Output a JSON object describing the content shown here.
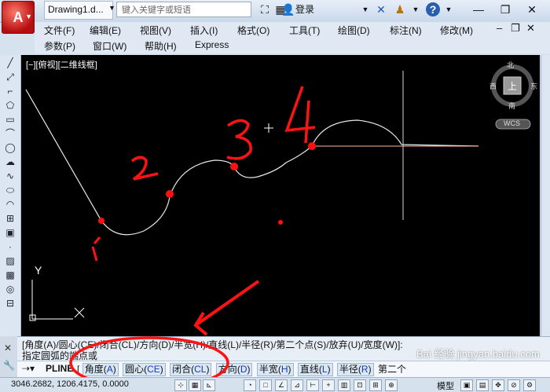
{
  "titlebar": {
    "doc_title": "Drawing1.d...",
    "search_placeholder": "键入关键字或短语",
    "login": "登录"
  },
  "menu": {
    "row1": [
      "文件(F)",
      "编辑(E)",
      "视图(V)",
      "插入(I)",
      "格式(O)",
      "工具(T)",
      "绘图(D)",
      "标注(N)",
      "修改(M)"
    ],
    "row2": [
      "参数(P)",
      "窗口(W)",
      "帮助(H)",
      "Express"
    ]
  },
  "canvas": {
    "view_label": "[−][俯视][二维线框]",
    "viewcube": {
      "north": "北",
      "south": "南",
      "east": "东",
      "west": "西",
      "top": "上",
      "wcs": "WCS"
    },
    "ucs_y": "Y",
    "annotations": [
      "1",
      "2",
      "3",
      "4"
    ]
  },
  "command": {
    "history": "[角度(A)/圆心(CE)/闭合(CL)/方向(D)/半宽(H)/直线(L)/半径(R)/第二个点(S)/放弃(U)/宽度(W)]:",
    "prompt": "指定圆弧的端点或",
    "pline": "PLINE",
    "bracket_open": "[",
    "options": [
      {
        "label": "角度",
        "key": "A"
      },
      {
        "label": "圆心",
        "key": "CE"
      },
      {
        "label": "闭合",
        "key": "CL"
      }
    ],
    "plain_options": [
      {
        "label": "方向",
        "key": "D"
      },
      {
        "label": "半宽",
        "key": "H"
      },
      {
        "label": "直线",
        "key": "L"
      },
      {
        "label": "半径",
        "key": "R"
      }
    ],
    "tail": "第二个"
  },
  "statusbar": {
    "coords": "3046.2682, 1206.4175, 0.0000",
    "model": "模型"
  },
  "watermark": "Bai 经验 jingyan.baidu.com"
}
